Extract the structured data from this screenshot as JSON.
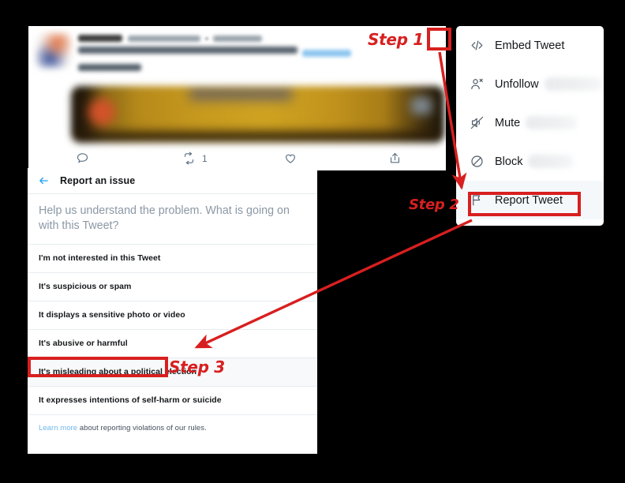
{
  "background_color": "#000000",
  "accent_red": "#d81f1f",
  "tweet": {
    "author_redacted": true,
    "actions": [
      {
        "icon": "reply-icon",
        "count": ""
      },
      {
        "icon": "retweet-icon",
        "count": "1"
      },
      {
        "icon": "like-icon",
        "count": ""
      },
      {
        "icon": "share-icon",
        "count": ""
      }
    ]
  },
  "menu": {
    "items": [
      {
        "icon": "embed-code-icon",
        "label": "Embed Tweet",
        "redacted_target": false,
        "highlighted": false
      },
      {
        "icon": "unfollow-person-icon",
        "label": "Unfollow",
        "redacted_target": true,
        "highlighted": false
      },
      {
        "icon": "mute-speaker-icon",
        "label": "Mute",
        "redacted_target": true,
        "highlighted": false
      },
      {
        "icon": "block-circle-icon",
        "label": "Block",
        "redacted_target": true,
        "highlighted": false
      },
      {
        "icon": "report-flag-icon",
        "label": "Report Tweet",
        "redacted_target": false,
        "highlighted": true
      }
    ]
  },
  "dialog": {
    "back_icon": "back-arrow-icon",
    "title": "Report an issue",
    "prompt": "Help us understand the problem. What is going on with this Tweet?",
    "options": [
      {
        "label": "I'm not interested in this Tweet",
        "highlighted": false
      },
      {
        "label": "It's suspicious or spam",
        "highlighted": false
      },
      {
        "label": "It displays a sensitive photo or video",
        "highlighted": false
      },
      {
        "label": "It's abusive or harmful",
        "highlighted": false
      },
      {
        "label": "It's misleading about a political election",
        "highlighted": true
      },
      {
        "label": "It expresses intentions of self-harm or suicide",
        "highlighted": false
      }
    ],
    "footer": {
      "link_text": "Learn more",
      "rest_text": " about reporting violations of our rules."
    }
  },
  "annotations": {
    "step1": "Step 1",
    "step2": "Step 2",
    "step3": "Step 3"
  }
}
